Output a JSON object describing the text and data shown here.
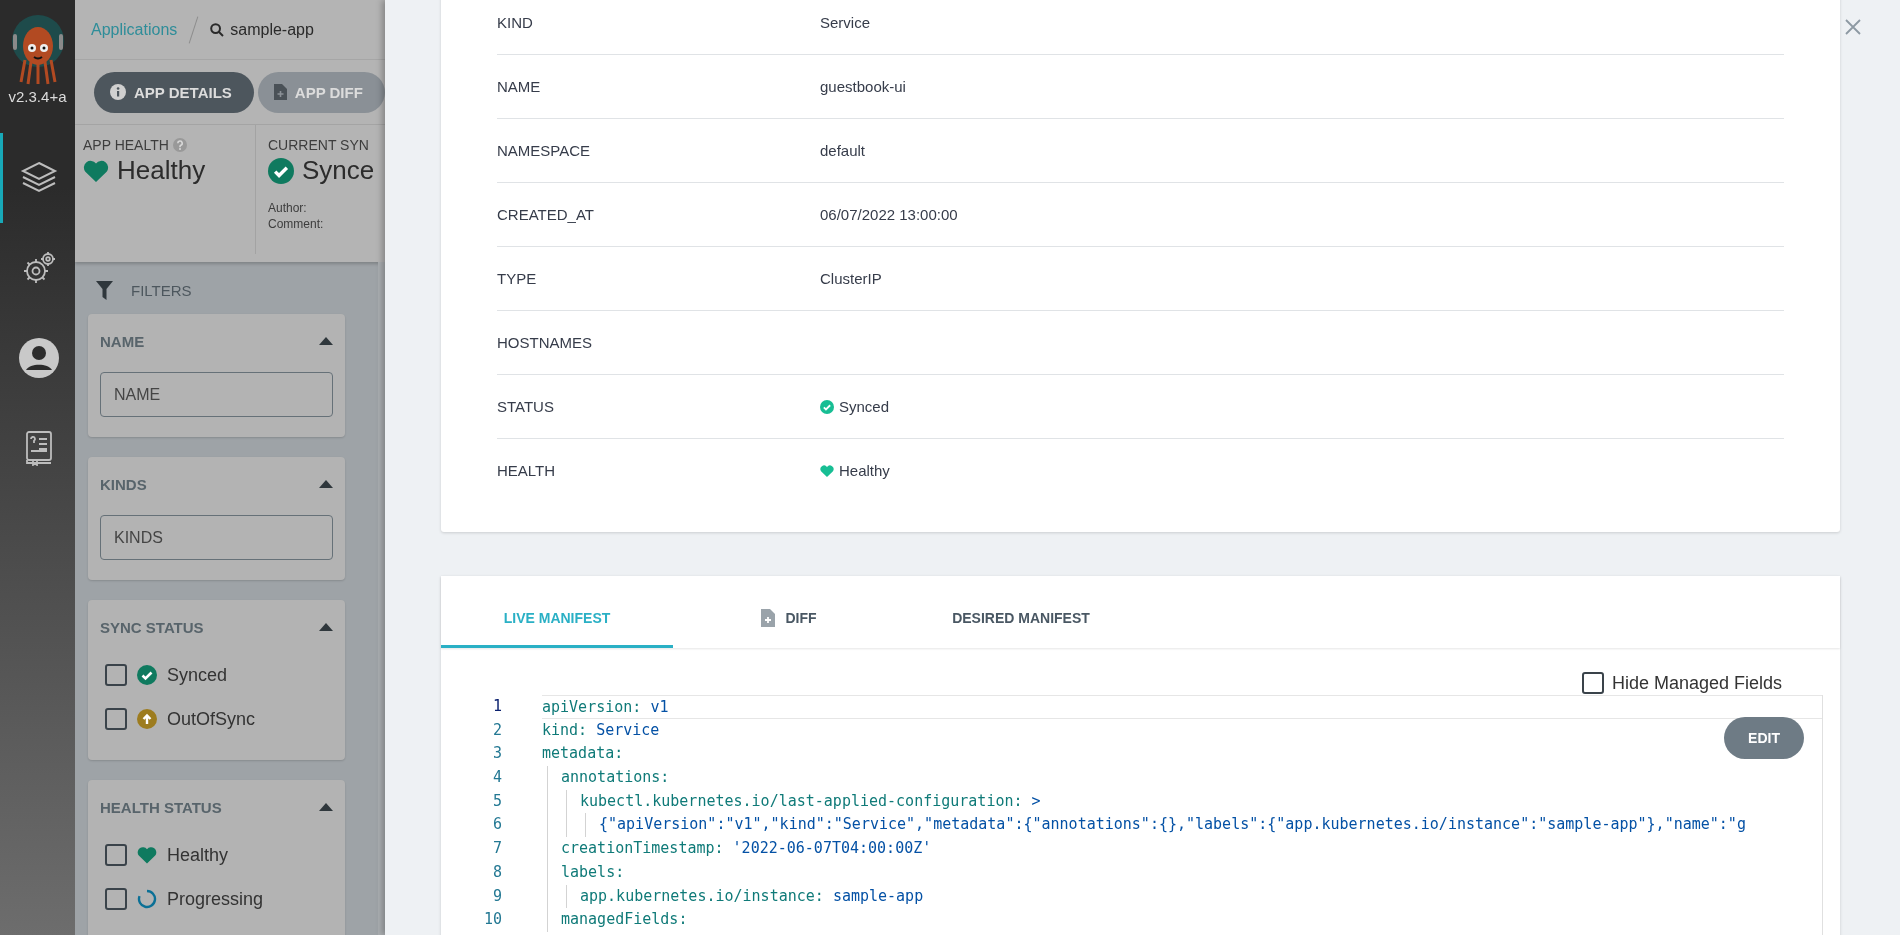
{
  "nav": {
    "version": "v2.3.4+a",
    "items": [
      {
        "selected": true
      },
      {
        "selected": false
      },
      {
        "selected": false
      },
      {
        "selected": false
      }
    ]
  },
  "breadcrumb": {
    "parent": "Applications",
    "current": "sample-app"
  },
  "buttons": [
    {
      "label": "APP DETAILS",
      "selected": true
    },
    {
      "label": "APP DIFF",
      "selected": false
    }
  ],
  "app_health": {
    "label": "APP HEALTH",
    "status": "Healthy"
  },
  "current_sync": {
    "label": "CURRENT SYN",
    "status": "Synce",
    "author_label": "Author:",
    "comment_label": "Comment:"
  },
  "filters": {
    "title": "FILTERS",
    "groups": [
      {
        "title": "NAME",
        "kind": "input",
        "placeholder": "NAME"
      },
      {
        "title": "KINDS",
        "kind": "input",
        "placeholder": "KINDS"
      },
      {
        "title": "SYNC STATUS",
        "kind": "checklist",
        "options": [
          {
            "label": "Synced",
            "kind": "synced",
            "checked": false
          },
          {
            "label": "OutOfSync",
            "kind": "outofsync",
            "checked": false
          }
        ]
      },
      {
        "title": "HEALTH STATUS",
        "kind": "checklist",
        "options": [
          {
            "label": "Healthy",
            "kind": "healthy",
            "checked": false
          },
          {
            "label": "Progressing",
            "kind": "progressing",
            "checked": false
          }
        ]
      }
    ]
  },
  "resource": {
    "rows": [
      {
        "label": "KIND",
        "value": "Service"
      },
      {
        "label": "NAME",
        "value": "guestbook-ui"
      },
      {
        "label": "NAMESPACE",
        "value": "default"
      },
      {
        "label": "CREATED_AT",
        "value": "06/07/2022 13:00:00"
      },
      {
        "label": "TYPE",
        "value": "ClusterIP"
      },
      {
        "label": "HOSTNAMES"
      },
      {
        "label": "STATUS",
        "value": "Synced",
        "kind": "synced"
      },
      {
        "label": "HEALTH",
        "value": "Healthy",
        "kind": "healthy"
      }
    ]
  },
  "manifest": {
    "tabs": [
      {
        "label": "LIVE MANIFEST",
        "selected": true,
        "has_icon": false
      },
      {
        "label": "DIFF",
        "selected": false,
        "has_icon": true
      },
      {
        "label": "DESIRED MANIFEST",
        "selected": false,
        "has_icon": false
      }
    ],
    "hide_managed_fields": {
      "label": "Hide Managed Fields",
      "checked": false
    },
    "edit_button": "EDIT",
    "lines": [
      {
        "number": "1",
        "key": "apiVersion:",
        "value": "v1"
      },
      {
        "number": "2",
        "key": "kind:",
        "value": "Service"
      },
      {
        "number": "3",
        "key": "metadata:",
        "children": [
          {
            "number": "4",
            "key": "annotations:",
            "children": [
              {
                "number": "5",
                "key": "kubectl.kubernetes.io/last-applied-configuration:",
                "value": ">",
                "children": [
                  {
                    "number": "6",
                    "value": "{\"apiVersion\":\"v1\",\"kind\":\"Service\",\"metadata\":{\"annotations\":{},\"labels\":{\"app.kubernetes.io/instance\":\"sample-app\"},\"name\":\"g"
                  }
                ]
              }
            ]
          },
          {
            "number": "7",
            "key": "creationTimestamp:",
            "value": "'2022-06-07T04:00:00Z'"
          },
          {
            "number": "8",
            "key": "labels:",
            "children": [
              {
                "number": "9",
                "key": "app.kubernetes.io/instance:",
                "value": "sample-app"
              }
            ]
          },
          {
            "number": "10",
            "key": "managedFields:"
          }
        ]
      }
    ]
  }
}
